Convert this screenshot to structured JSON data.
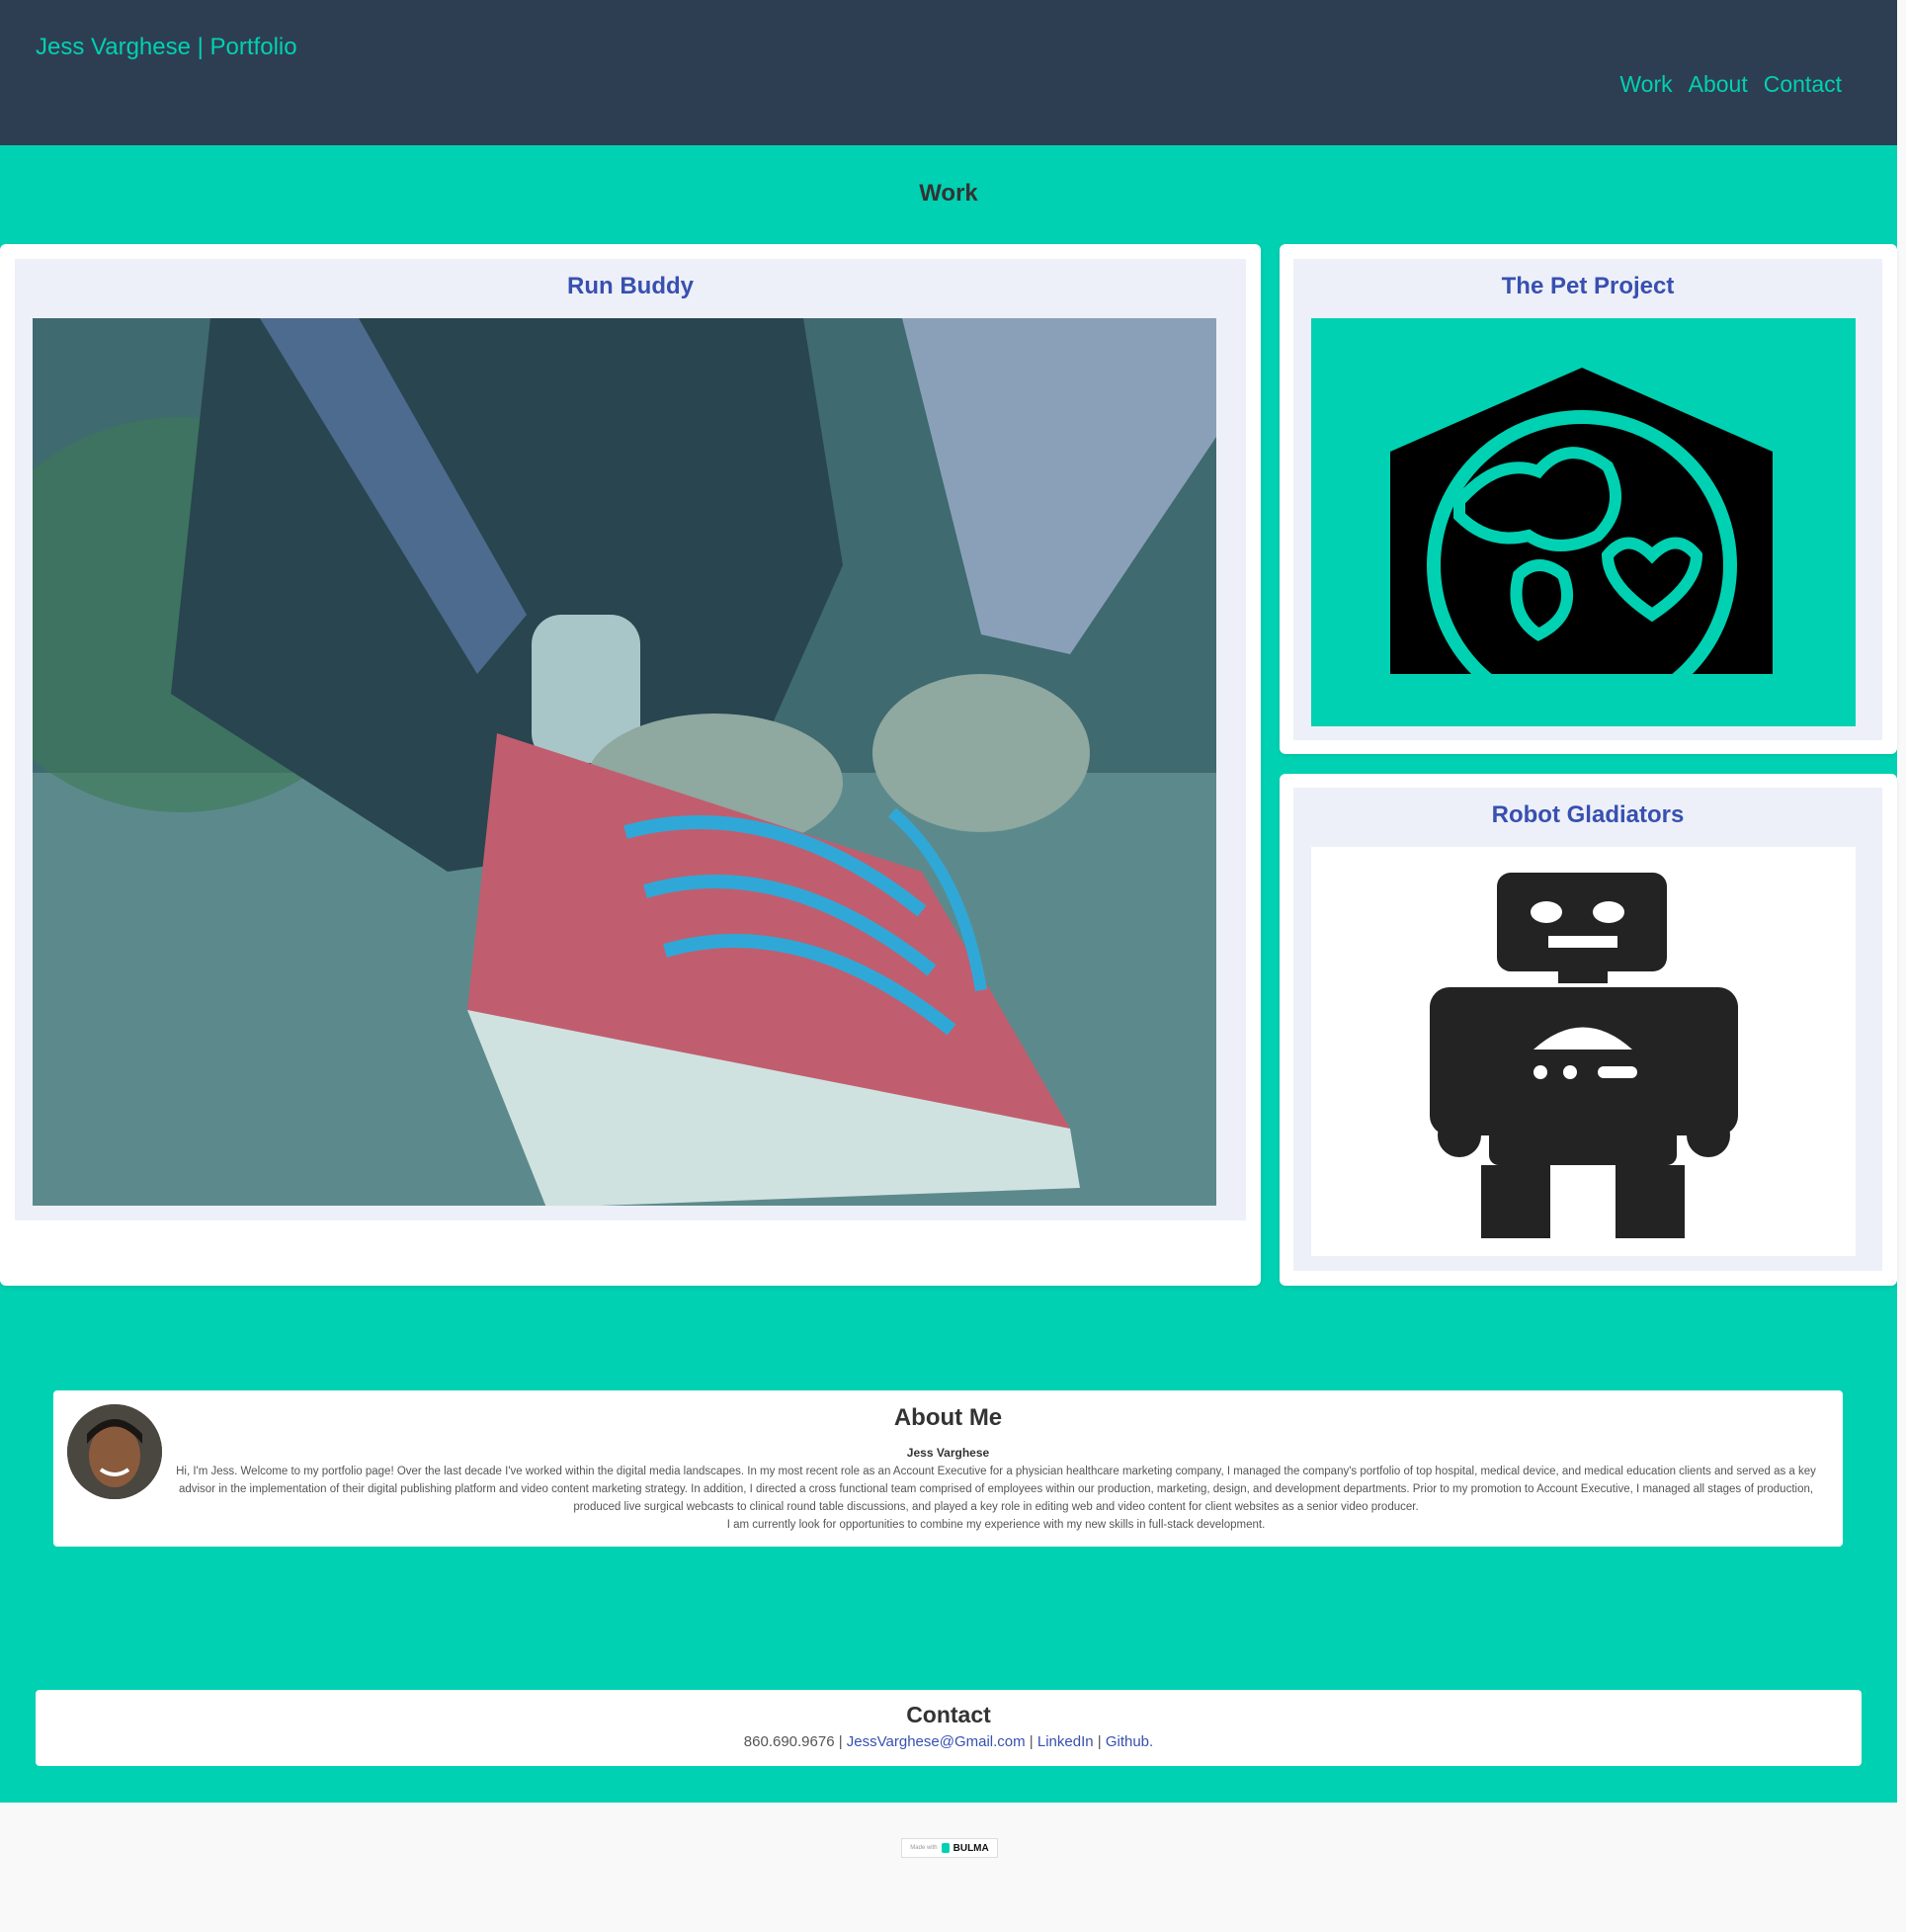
{
  "nav": {
    "brand": "Jess Varghese | Portfolio",
    "links": [
      "Work",
      "About",
      "Contact"
    ]
  },
  "work": {
    "title": "Work",
    "projects": [
      {
        "title": "Run Buddy",
        "image": "running-shoe-photo"
      },
      {
        "title": "The Pet Project",
        "image": "pet-house-icon"
      },
      {
        "title": "Robot Gladiators",
        "image": "robot-icon"
      }
    ]
  },
  "about": {
    "title": "About Me",
    "name": "Jess Varghese",
    "paragraph": "Hi, I'm Jess. Welcome to my portfolio page! Over the last decade I've worked within the digital media landscapes. In my most recent role as an Account Executive for a physician healthcare marketing company, I managed the company's portfolio of top hospital, medical device, and medical education clients and served as a key advisor in the implementation of their digital publishing platform and video content marketing strategy. In addition, I directed a cross functional team comprised of employees within our production, marketing, design, and development departments. Prior to my promotion to Account Executive, I managed all stages of production, produced live surgical webcasts to clinical round table discussions, and played a key role in editing web and video content for client websites as a senior video producer.",
    "paragraph2": "I am currently look for opportunities to combine my experience with my new skills in full-stack development."
  },
  "contact": {
    "title": "Contact",
    "phone": "860.690.9676",
    "sep1": " | ",
    "email": "JessVarghese@Gmail.com",
    "sep2": " | ",
    "linkedin": "LinkedIn",
    "sep3": " | ",
    "github": "Github."
  },
  "footer": {
    "made_with": "Made with",
    "bulma": "BULMA"
  },
  "colors": {
    "primary": "#00d1b2",
    "navbar": "#2e3e52",
    "link": "#3850b0"
  }
}
